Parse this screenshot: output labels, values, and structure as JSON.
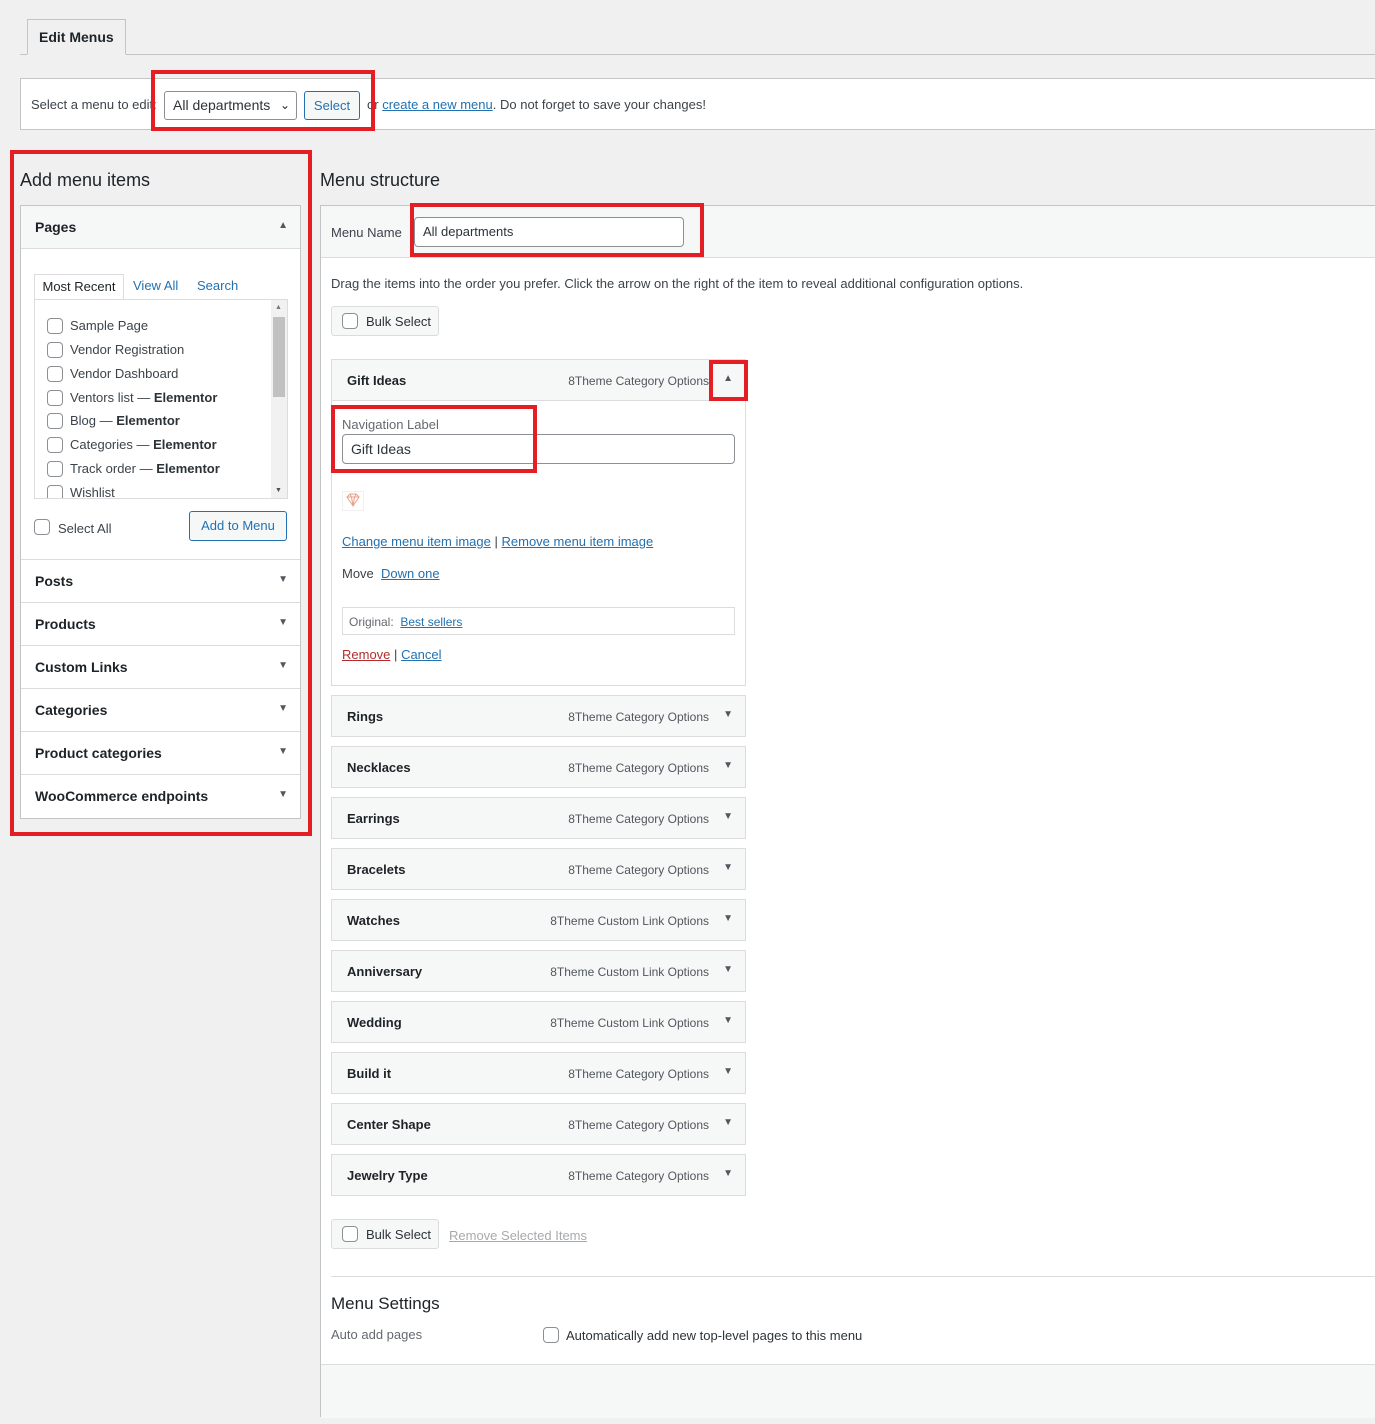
{
  "tabs": {
    "edit_menus": "Edit Menus"
  },
  "manage": {
    "label": "Select a menu to edit:",
    "selected_menu": "All departments",
    "select_button": "Select",
    "or": "or",
    "create_link": "create a new menu",
    "reminder": ". Do not forget to save your changes!"
  },
  "add_items": {
    "heading": "Add menu items",
    "pages": {
      "title": "Pages",
      "tabs": [
        "Most Recent",
        "View All",
        "Search"
      ],
      "items": [
        {
          "label": "Sample Page",
          "suffix": ""
        },
        {
          "label": "Vendor Registration",
          "suffix": ""
        },
        {
          "label": "Vendor Dashboard",
          "suffix": ""
        },
        {
          "label": "Ventors list — ",
          "suffix": "Elementor"
        },
        {
          "label": "Blog — ",
          "suffix": "Elementor"
        },
        {
          "label": "Categories — ",
          "suffix": "Elementor"
        },
        {
          "label": "Track order — ",
          "suffix": "Elementor"
        },
        {
          "label": "Wishlist",
          "suffix": ""
        }
      ],
      "select_all": "Select All",
      "add_button": "Add to Menu"
    },
    "sections": [
      "Posts",
      "Products",
      "Custom Links",
      "Categories",
      "Product categories",
      "WooCommerce endpoints"
    ]
  },
  "structure": {
    "heading": "Menu structure",
    "menu_name_label": "Menu Name",
    "menu_name_value": "All departments",
    "instructions": "Drag the items into the order you prefer. Click the arrow on the right of the item to reveal additional configuration options.",
    "bulk_select": "Bulk Select",
    "open_item": {
      "title": "Gift Ideas",
      "type": "8Theme Category Options",
      "nav_label_caption": "Navigation Label",
      "nav_label_value": "Gift Ideas",
      "change_image": "Change menu item image",
      "divider": "|",
      "remove_image": "Remove menu item image",
      "move_label": "Move",
      "move_link": "Down one",
      "original_label": "Original:",
      "original_link": "Best sellers",
      "remove": "Remove",
      "cancel": "Cancel"
    },
    "items": [
      {
        "title": "Rings",
        "type": "8Theme Category Options"
      },
      {
        "title": "Necklaces",
        "type": "8Theme Category Options"
      },
      {
        "title": "Earrings",
        "type": "8Theme Category Options"
      },
      {
        "title": "Bracelets",
        "type": "8Theme Category Options"
      },
      {
        "title": "Watches",
        "type": "8Theme Custom Link Options"
      },
      {
        "title": "Anniversary",
        "type": "8Theme Custom Link Options"
      },
      {
        "title": "Wedding",
        "type": "8Theme Custom Link Options"
      },
      {
        "title": "Build it",
        "type": "8Theme Category Options"
      },
      {
        "title": "Center Shape",
        "type": "8Theme Category Options"
      },
      {
        "title": "Jewelry Type",
        "type": "8Theme Category Options"
      }
    ],
    "remove_selected": "Remove Selected Items",
    "settings": {
      "heading": "Menu Settings",
      "auto_add_label": "Auto add pages",
      "auto_add_text": "Automatically add new top-level pages to this menu"
    }
  },
  "icons": {
    "collapse": "triangle-up-icon",
    "expand": "triangle-down-icon",
    "dropdown": "chevron-down-icon",
    "item_image": "diamond-icon"
  },
  "colors": {
    "highlight": "#e31e24",
    "link": "#2271b1",
    "remove": "#b32d2e"
  }
}
